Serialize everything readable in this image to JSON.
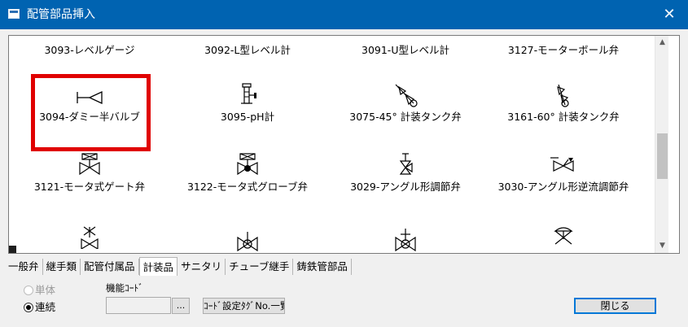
{
  "window": {
    "title": "配管部品挿入",
    "close_glyph": "✕"
  },
  "grid": {
    "row0": [
      "3093-レベルゲージ",
      "3092-L型レベル計",
      "3091-U型レベル計",
      "3127-モーターボール弁"
    ],
    "row1": [
      "3094-ダミー半バルブ",
      "3095-pH計",
      "3075-45° 計装タンク弁",
      "3161-60° 計装タンク弁"
    ],
    "row2": [
      "3121-モータ式ゲート弁",
      "3122-モータ式グローブ弁",
      "3029-アングル形調節弁",
      "3030-アングル形逆流調節弁"
    ]
  },
  "scrollbar": {
    "up": "▲",
    "down": "▼"
  },
  "tabs": [
    "一般弁",
    "継手類",
    "配管付属品",
    "計装品",
    "サニタリ",
    "チューブ継手",
    "鋳鉄管部品"
  ],
  "active_tab": "計装品",
  "options": {
    "single": "単体",
    "continuous": "連続",
    "selected": "連続"
  },
  "code": {
    "label": "機能ｺｰﾄﾞ",
    "value": "",
    "browse": "...",
    "list_button": "ｺｰﾄﾞ設定ﾀｸﾞNo.一覧"
  },
  "close_button": "閉じる"
}
